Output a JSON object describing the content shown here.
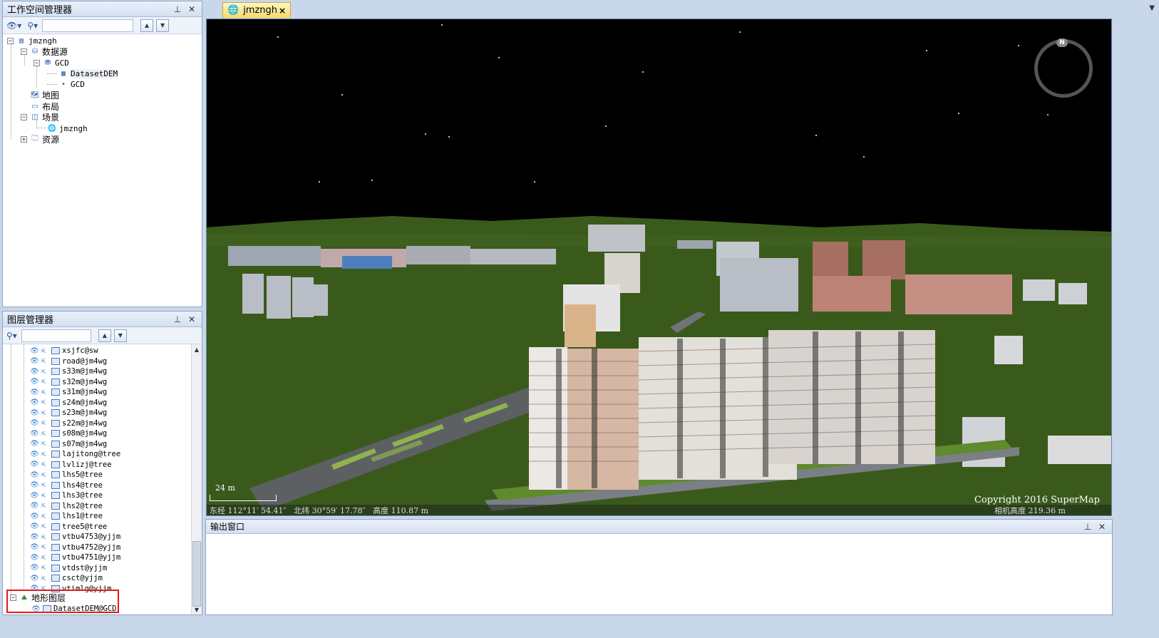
{
  "workspace_panel": {
    "title": "工作空间管理器",
    "pin_icon": "pin-icon",
    "close_icon": "close-icon",
    "tree": {
      "root": "jmzngh",
      "datasources": "数据源",
      "gcd_source": "GCD",
      "dataset_dem": "DatasetDEM",
      "dataset_gcd": "GCD",
      "maps": "地图",
      "layouts": "布局",
      "scenes": "场景",
      "scene_item": "jmzngh",
      "resources": "资源"
    }
  },
  "layer_panel": {
    "title": "图层管理器",
    "layers": [
      "xsjfc@sw",
      "road@jm4wg",
      "s33m@jm4wg",
      "s32m@jm4wg",
      "s31m@jm4wg",
      "s24m@jm4wg",
      "s23m@jm4wg",
      "s22m@jm4wg",
      "s08m@jm4wg",
      "s07m@jm4wg",
      "lajitong@tree",
      "lvlizj@tree",
      "lhs5@tree",
      "lhs4@tree",
      "lhs3@tree",
      "lhs2@tree",
      "lhs1@tree",
      "tree5@tree",
      "vtbu4753@yjjm",
      "vtbu4752@yjjm",
      "vtbu4751@yjjm",
      "vtdst@yjjm",
      "csct@yjjm",
      "vtimlg@yjjm"
    ],
    "terrain_group": "地形图层",
    "terrain_layer": "DatasetDEM@GCD"
  },
  "scene_tab": {
    "label": "jmzngh",
    "close": "×"
  },
  "scene_view": {
    "scale_label": "24 m",
    "status_text": "东经 112°11′ 54.41″   北纬 30°59′ 17.78″   高度 110.87 m",
    "camera_height": "相机高度 219.36 m",
    "copyright": "Copyright 2016 SuperMap",
    "compass_label": "N"
  },
  "output_panel": {
    "title": "输出窗口"
  },
  "colors": {
    "panel_border": "#8ea4c1",
    "tab_active": "#f7d96a",
    "terrain": "#3a5a1c",
    "highlight_box": "#e21b1b"
  }
}
